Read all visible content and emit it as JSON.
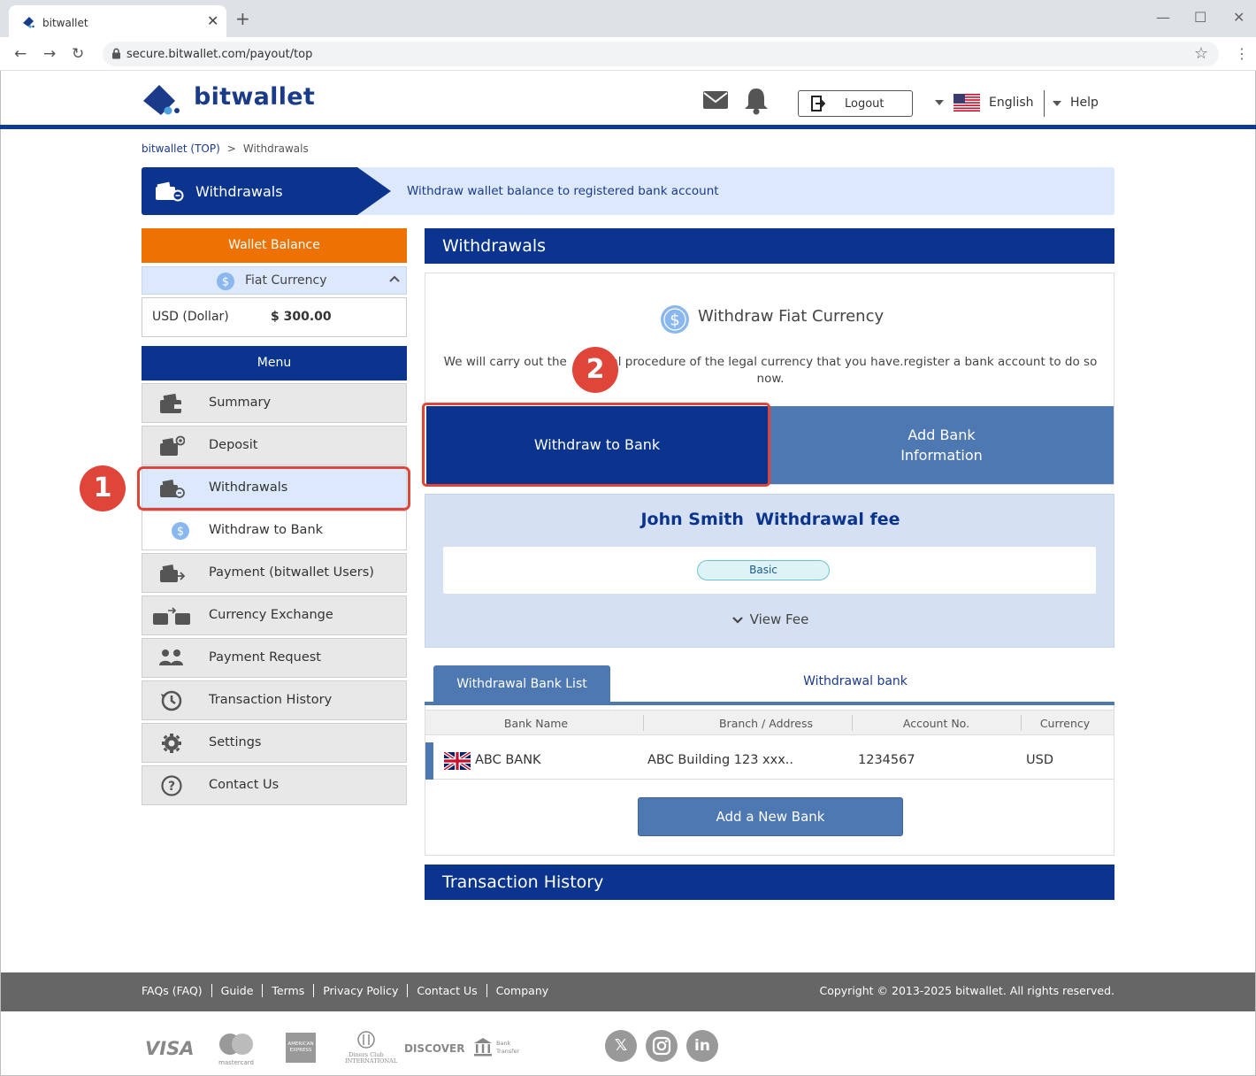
{
  "browser": {
    "tab_title": "bitwallet",
    "url": "secure.bitwallet.com/payout/top"
  },
  "header": {
    "brand": "bitwallet",
    "logout_label": "Logout",
    "language": "English",
    "help_label": "Help"
  },
  "breadcrumb": {
    "home": "bitwallet (TOP)",
    "separator": ">",
    "current": "Withdrawals"
  },
  "banner": {
    "title": "Withdrawals",
    "description": "Withdraw wallet balance to registered bank account"
  },
  "sidebar": {
    "wallet_balance_title": "Wallet Balance",
    "fiat_label": "Fiat Currency",
    "balance_currency": "USD (Dollar)",
    "balance_amount": "$ 300.00",
    "menu_title": "Menu",
    "items": [
      {
        "label": "Summary"
      },
      {
        "label": "Deposit"
      },
      {
        "label": "Withdrawals"
      },
      {
        "label": "Withdraw to Bank"
      },
      {
        "label": "Payment (bitwallet Users)"
      },
      {
        "label": "Currency Exchange"
      },
      {
        "label": "Payment Request"
      },
      {
        "label": "Transaction History"
      },
      {
        "label": "Settings"
      },
      {
        "label": "Contact Us"
      }
    ]
  },
  "annotations": {
    "step1": "1",
    "step2": "2"
  },
  "main": {
    "section_title": "Withdrawals",
    "card_title": "Withdraw Fiat Currency",
    "card_desc_before": "We will carry out the",
    "card_desc_after": "wal procedure of the legal currency that you have.register a bank account to do so now.",
    "withdraw_button": "Withdraw to Bank",
    "add_bank_line1": "Add Bank",
    "add_bank_line2": "Information",
    "fee_title": "John Smith  Withdrawal fee",
    "fee_plan": "Basic",
    "view_fee": "View Fee",
    "tabs": [
      "Withdrawal Bank List",
      "Withdrawal bank"
    ],
    "table": {
      "headers": [
        "Bank Name",
        "Branch / Address",
        "Account No.",
        "Currency"
      ],
      "rows": [
        {
          "bank": "ABC BANK",
          "branch": "ABC Building 123 xxx..",
          "account": "1234567",
          "currency": "USD"
        }
      ]
    },
    "add_new_bank": "Add a New Bank",
    "history_title": "Transaction History"
  },
  "footer": {
    "links": [
      "FAQs (FAQ)",
      "Guide",
      "Terms",
      "Privacy Policy",
      "Contact Us",
      "Company"
    ],
    "copyright": "Copyright © 2013-2025 bitwallet. All rights reserved.",
    "payment_logos": [
      "VISA",
      "mastercard",
      "AMERICAN EXPRESS",
      "Diners Club INTERNATIONAL",
      "DISCOVER",
      "Bank Transfer"
    ]
  },
  "colors": {
    "brand": "#0a348d",
    "accent": "#ee7203",
    "secondary": "#4e78b2",
    "highlight": "#e0453a"
  }
}
